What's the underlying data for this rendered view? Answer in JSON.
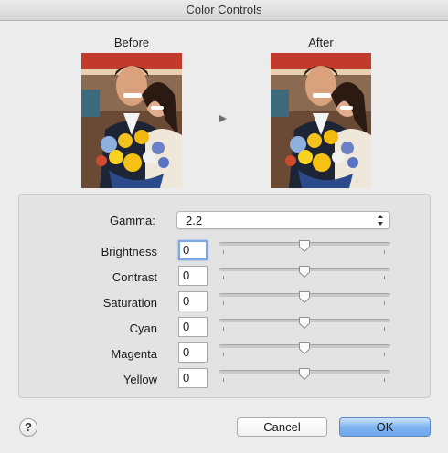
{
  "window": {
    "title": "Color Controls"
  },
  "preview": {
    "before_label": "Before",
    "after_label": "After",
    "arrow_icon": "play-right-icon"
  },
  "gamma": {
    "label": "Gamma:",
    "value": "2.2"
  },
  "controls": [
    {
      "label": "Brightness",
      "value": "0",
      "slider_fraction": 0.5,
      "focused": true
    },
    {
      "label": "Contrast",
      "value": "0",
      "slider_fraction": 0.5
    },
    {
      "label": "Saturation",
      "value": "0",
      "slider_fraction": 0.5
    },
    {
      "label": "Cyan",
      "value": "0",
      "slider_fraction": 0.5
    },
    {
      "label": "Magenta",
      "value": "0",
      "slider_fraction": 0.5
    },
    {
      "label": "Yellow",
      "value": "0",
      "slider_fraction": 0.5
    }
  ],
  "buttons": {
    "help_label": "?",
    "cancel_label": "Cancel",
    "ok_label": "OK"
  },
  "colors": {
    "default_button": "#6ea6ec",
    "focus_ring": "#7aa7e6"
  }
}
